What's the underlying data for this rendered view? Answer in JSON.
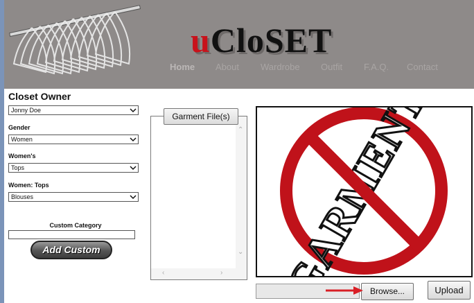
{
  "header": {
    "logo_first": "u",
    "logo_rest": "CloSET",
    "nav": [
      "Home",
      "About",
      "Wardrobe",
      "Outfit",
      "F.A.Q.",
      "Contact"
    ]
  },
  "sidebar": {
    "title": "Closet Owner",
    "owner_value": "Jonny Doe",
    "gender_label": "Gender",
    "gender_value": "Women",
    "category_label": "Women's",
    "category_value": "Tops",
    "subcategory_label": "Women: Tops",
    "subcategory_value": "Blouses",
    "custom_label": "Custom Category",
    "custom_value": "",
    "add_custom_label": "Add Custom"
  },
  "files": {
    "tab_label": "Garment File(s)"
  },
  "preview": {
    "image_word": "GARMENT",
    "colors": {
      "ring": "#c0121a"
    }
  },
  "upload": {
    "path_value": "",
    "browse_label": "Browse...",
    "upload_label": "Upload"
  }
}
